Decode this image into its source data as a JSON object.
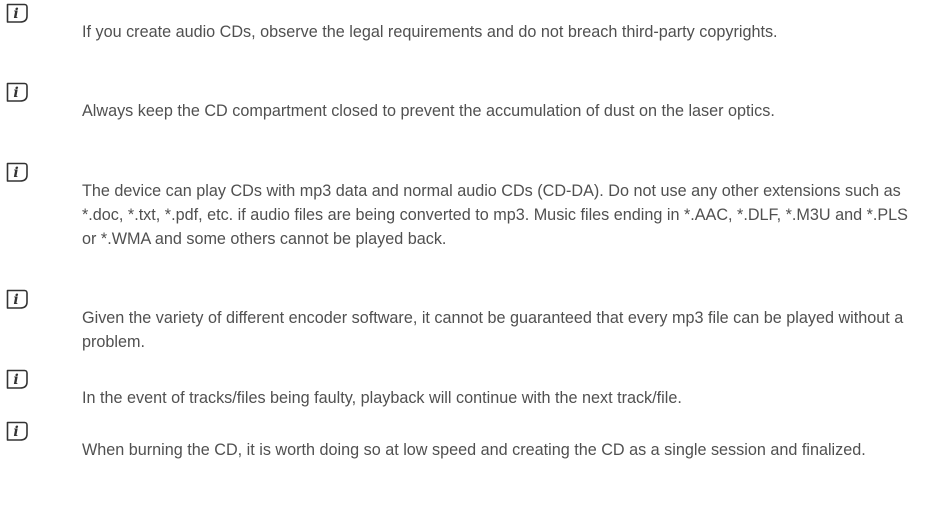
{
  "notes": [
    {
      "icon": "info-icon",
      "text": "If you create audio CDs, observe the legal requirements and do not breach third-party copyrights."
    },
    {
      "icon": "info-icon",
      "text": "Always keep the CD compartment closed to prevent the accumulation of dust on the laser optics."
    },
    {
      "icon": "info-icon",
      "text": "The device can play CDs with mp3 data and normal audio CDs (CD-DA). Do not use any other extensions such as *.doc, *.txt, *.pdf, etc. if audio files are being converted to mp3. Music files ending in *.AAC, *.DLF, *.M3U and *.PLS or *.WMA and some others cannot be played back."
    },
    {
      "icon": "info-icon",
      "text": "Given the variety of different encoder software, it cannot be guaranteed that every mp3 file can be played without a problem."
    },
    {
      "icon": "info-icon",
      "text": "In the event of tracks/files being faulty, playback will continue with the next track/file."
    },
    {
      "icon": "info-icon",
      "text": "When burning the CD, it is worth doing so at low speed and creating the CD as a single session and finalized."
    }
  ]
}
